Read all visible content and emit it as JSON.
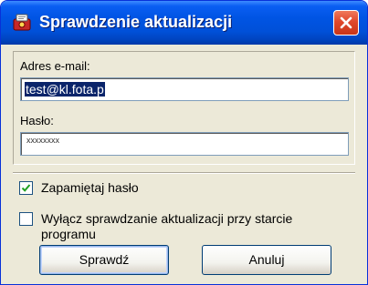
{
  "window": {
    "title": "Sprawdzenie aktualizacji",
    "app_icon": "program-icon",
    "close_icon": "close-icon"
  },
  "form": {
    "email_label": "Adres e-mail:",
    "email_value": "test@kl.fota.p",
    "password_label": "Hasło:",
    "password_value": "xxxxxxxx"
  },
  "options": {
    "remember_password": {
      "label": "Zapamiętaj hasło",
      "checked": true
    },
    "disable_check_on_startup": {
      "label": "Wyłącz sprawdzanie aktualizacji przy starcie programu",
      "checked": false
    }
  },
  "buttons": {
    "check_label": "Sprawdź",
    "cancel_label": "Anuluj"
  },
  "colors": {
    "titlebar": "#0054e3",
    "close_button": "#e0482c",
    "dialog_background": "#ece9d8",
    "selection": "#0a246a"
  }
}
